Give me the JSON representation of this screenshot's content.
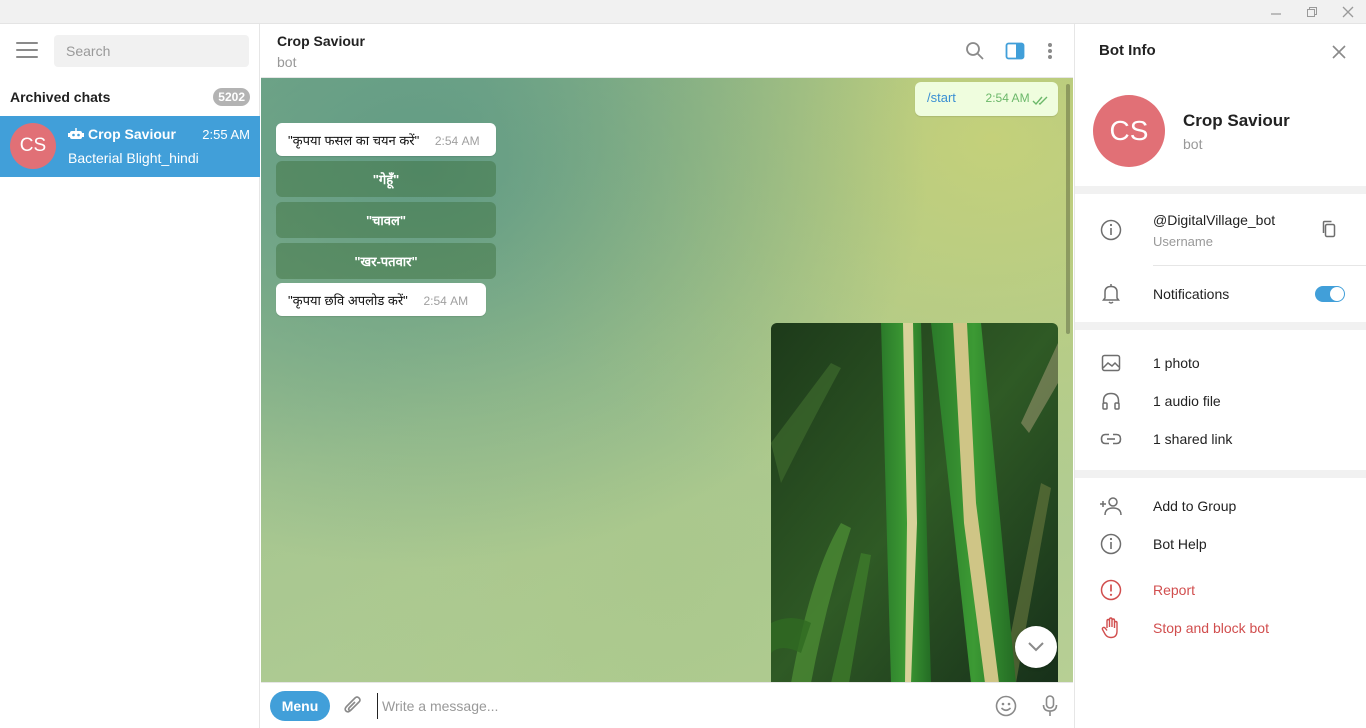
{
  "window": {
    "minimize": "minimize-icon",
    "restore": "restore-icon",
    "close": "close-icon"
  },
  "sidebar": {
    "search_placeholder": "Search",
    "archived_label": "Archived chats",
    "archived_count": "5202",
    "chat": {
      "avatar_initials": "CS",
      "name": "Crop Saviour",
      "time": "2:55 AM",
      "preview": "Bacterial Blight_hindi"
    }
  },
  "chat": {
    "title": "Crop Saviour",
    "subtitle": "bot",
    "messages": {
      "out1": {
        "text": "/start",
        "time": "2:54 AM"
      },
      "in1": {
        "text": "\"कृपया फसल का चयन करें\"",
        "time": "2:54 AM"
      },
      "buttons": [
        "\"गेहूँ\"",
        "\"चावल\"",
        "\"खर-पतवार\""
      ],
      "in2": {
        "text": "\"कृपया छवि अपलोड करें\"",
        "time": "2:54 AM"
      }
    },
    "composer": {
      "menu_label": "Menu",
      "placeholder": "Write a message..."
    }
  },
  "info": {
    "title": "Bot Info",
    "avatar_initials": "CS",
    "name": "Crop Saviour",
    "subtitle": "bot",
    "username": "@DigitalVillage_bot",
    "username_label": "Username",
    "notifications_label": "Notifications",
    "notifications_on": true,
    "media": [
      "1 photo",
      "1 audio file",
      "1 shared link"
    ],
    "actions": [
      "Add to Group",
      "Bot Help"
    ],
    "danger": [
      "Report",
      "Stop and block bot"
    ]
  },
  "colors": {
    "accent": "#419fd9",
    "avatar": "#e17076",
    "danger": "#d14e4e"
  }
}
